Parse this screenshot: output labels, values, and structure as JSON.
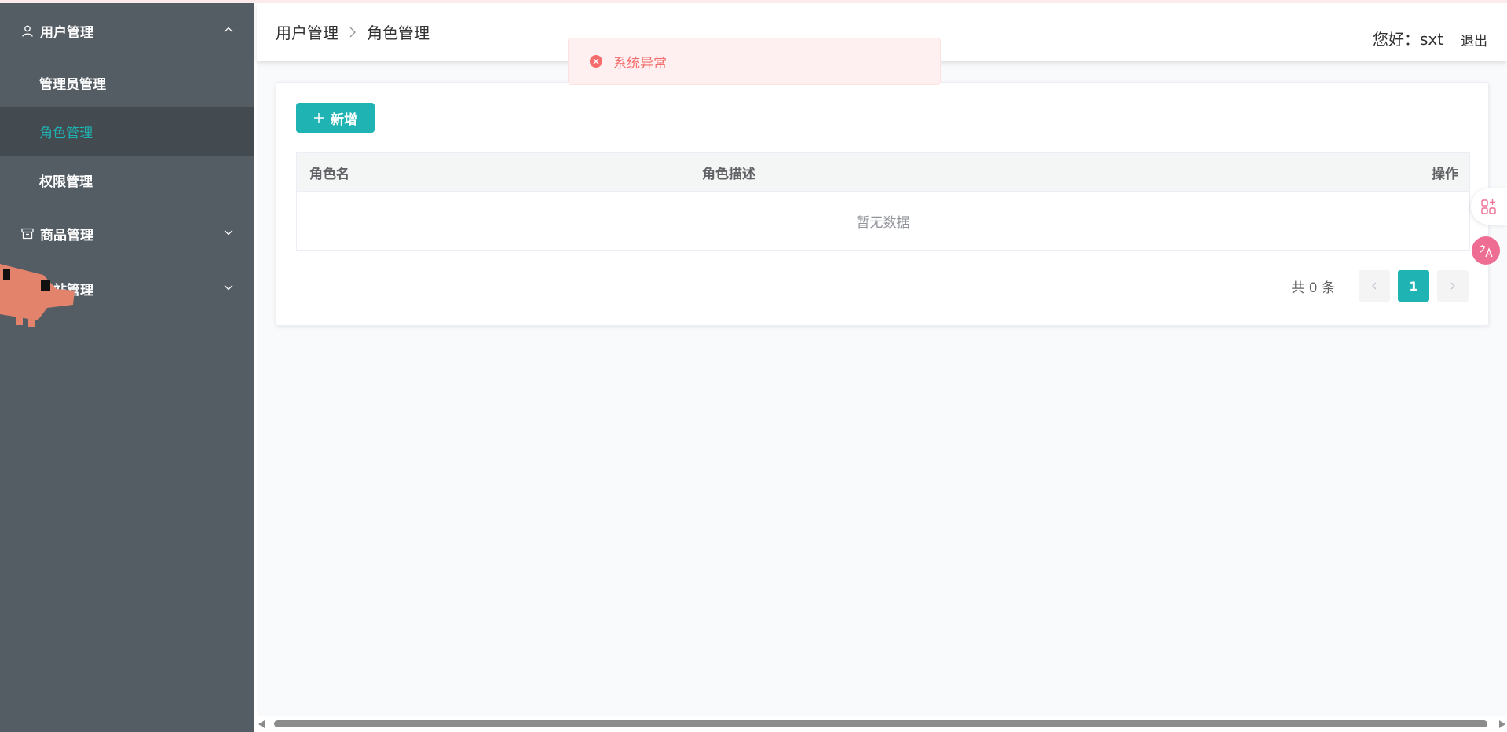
{
  "sidebar": {
    "groups": [
      {
        "label": "用户管理",
        "icon": "user-icon",
        "expanded": true
      },
      {
        "label": "商品管理",
        "icon": "box-icon",
        "expanded": false
      },
      {
        "label": "站管理",
        "icon": "",
        "expanded": false
      }
    ],
    "sub_items": [
      {
        "label": "管理员管理",
        "active": false
      },
      {
        "label": "角色管理",
        "active": true
      },
      {
        "label": "权限管理",
        "active": false
      }
    ]
  },
  "header": {
    "breadcrumb": [
      "用户管理",
      "角色管理"
    ],
    "greeting": "您好：sxt",
    "logout_label": "退出"
  },
  "toast": {
    "message": "系统异常",
    "type": "error"
  },
  "toolbar": {
    "add_label": "新增"
  },
  "table": {
    "columns": [
      "角色名",
      "角色描述",
      "操作"
    ],
    "rows": [],
    "empty_text": "暂无数据"
  },
  "pagination": {
    "total_text": "共 0 条",
    "current_page": "1"
  },
  "colors": {
    "sidebar_bg": "#545c64",
    "active_item_bg": "#434a50",
    "accent": "#1fb3b3",
    "error": "#f56c6c",
    "floating_pink": "#ee6e93"
  }
}
